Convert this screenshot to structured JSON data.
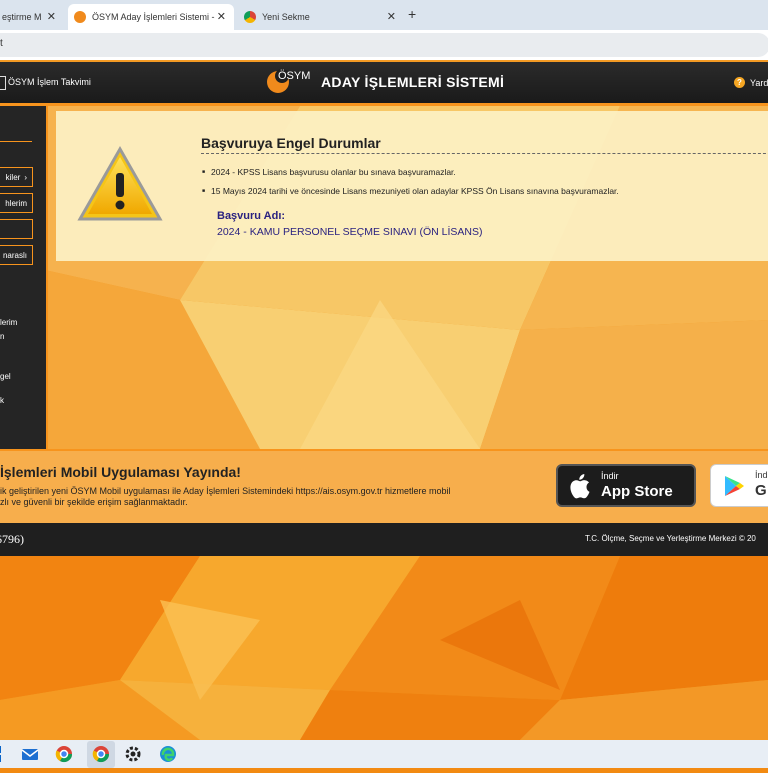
{
  "browser": {
    "tabs": [
      {
        "title": "eştirme M",
        "active": false
      },
      {
        "title": "ÖSYM Aday İşlemleri Sistemi -",
        "active": true
      },
      {
        "title": "Yeni Sekme",
        "active": false
      }
    ],
    "close_glyph": "✕",
    "new_tab_glyph": "+",
    "address": "t"
  },
  "header": {
    "calendar_label": "ÖSYM İşlem Takvimi",
    "logo_text": "ÖSYM",
    "title": "ADAY İŞLEMLERİ SİSTEMİ",
    "help_glyph": "?",
    "help_label": "Yard"
  },
  "sidebar": {
    "buttons": [
      "kiler",
      "hlerim",
      "",
      "naraslı"
    ],
    "texts": [
      "lerim",
      "n",
      "gel",
      "k"
    ]
  },
  "warning": {
    "title": "Başvuruya Engel Durumlar",
    "items": [
      "2024 - KPSS Lisans başvurusu olanlar bu sınava başvuramazlar.",
      "15 Mayıs 2024 tarihi ve öncesinde Lisans mezuniyeti olan adaylar KPSS Ön Lisans sınavına başvuramazlar."
    ],
    "application_label": "Başvuru Adı:",
    "application_value": "2024 - KAMU PERSONEL SEÇME SINAVI (ÖN LİSANS)"
  },
  "banner": {
    "title": "İşlemleri Mobil Uygulaması Yayında!",
    "desc_line1": "ik geliştirilen yeni ÖSYM Mobil uygulaması ile Aday İşlemleri Sistemindeki https://ais.osym.gov.tr hizmetlere mobil",
    "desc_line2": "zlı ve güvenli bir şekilde erişim sağlanmaktadır.",
    "appstore_small": "İndir",
    "appstore_big": "App Store",
    "googleplay_small": "İndi",
    "googleplay_big": "G"
  },
  "footer": {
    "left": "6796)",
    "right": "T.C. Ölçme, Seçme ve Yerleştirme Merkezi © 20"
  },
  "colors": {
    "accent": "#f7941d",
    "header_bg": "#1f1f1f",
    "link_blue": "#2a2280"
  },
  "taskbar": {
    "icons": [
      "windows-icon",
      "mail-icon",
      "chrome-icon",
      "chrome-active-icon",
      "settings-icon",
      "edge-icon"
    ]
  }
}
